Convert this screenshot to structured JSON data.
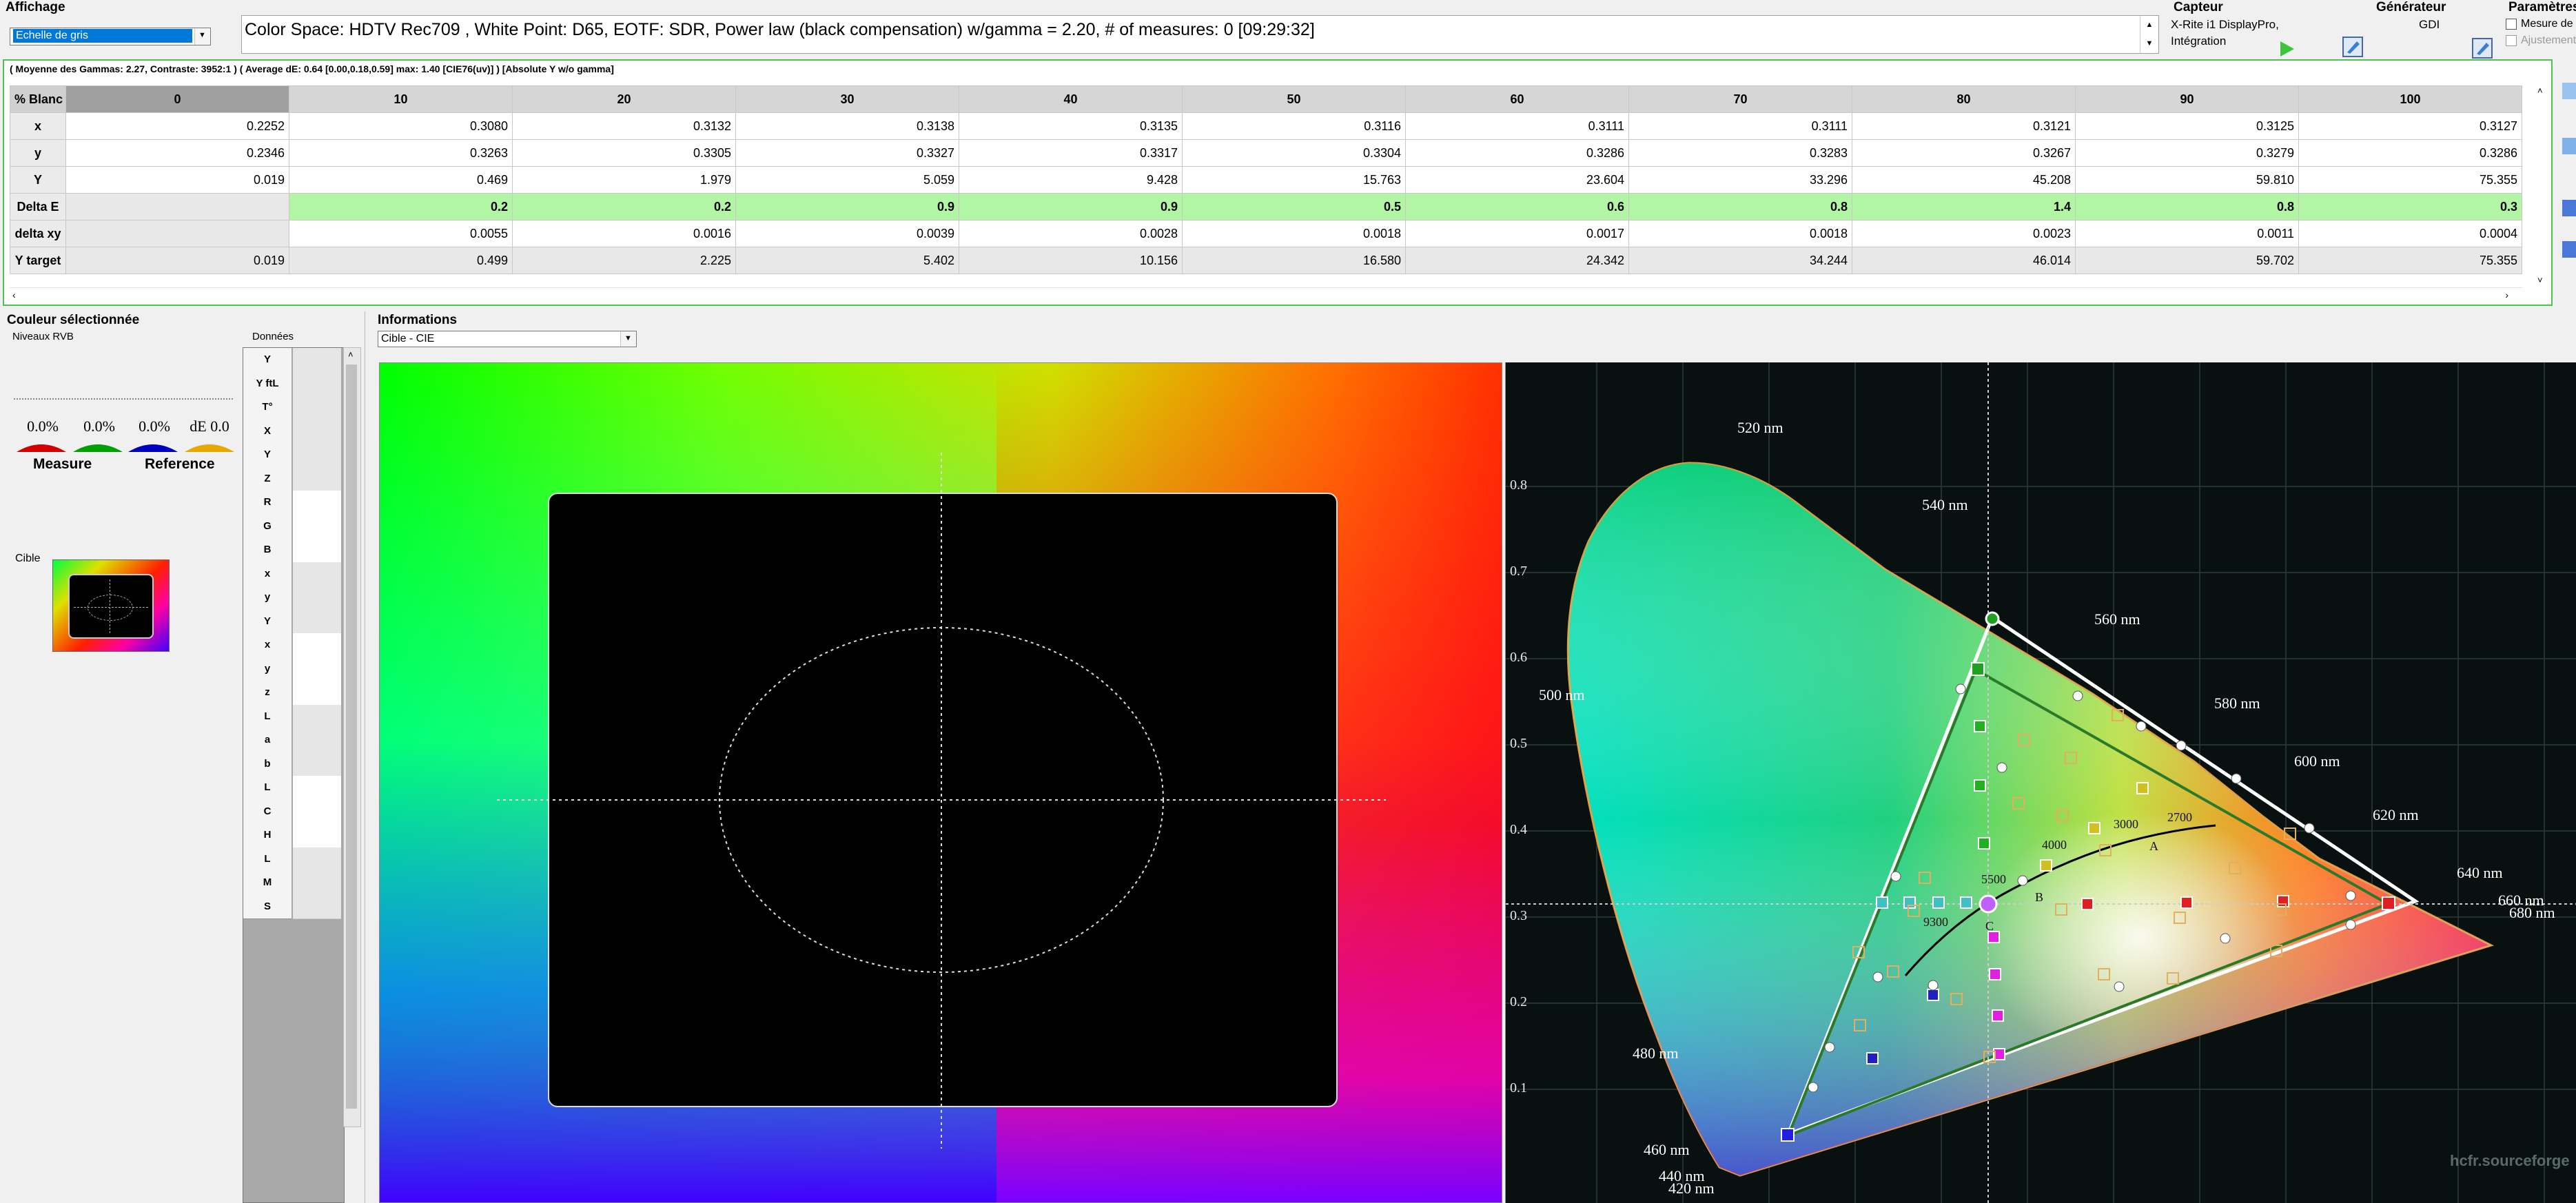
{
  "display": {
    "group_label": "Affichage",
    "mode": "Echelle de gris",
    "status": "Color Space: HDTV Rec709 , White Point: D65, EOTF:  SDR, Power law (black compensation) w/gamma = 2.20, # of measures: 0 [09:29:32]"
  },
  "sensor": {
    "group_label": "Capteur",
    "device": "X-Rite i1 DisplayPro,",
    "mode": "Intégration"
  },
  "generator": {
    "group_label": "Générateur",
    "value": "GDI"
  },
  "params": {
    "group_label": "Paramètres",
    "check1": "Mesure de",
    "check2": "Ajustement"
  },
  "summary": "( Moyenne des Gammas: 2.27, Contraste: 3952:1 ) ( Average dE: 0.64 [0.00,0.18,0.59] max: 1.40 [CIE76(uv)] ) [Absolute Y w/o gamma]",
  "table": {
    "corner": "% Blanc",
    "columns": [
      "0",
      "10",
      "20",
      "30",
      "40",
      "50",
      "60",
      "70",
      "80",
      "90",
      "100"
    ],
    "rows": [
      {
        "label": "x",
        "values": [
          "0.2252",
          "0.3080",
          "0.3132",
          "0.3138",
          "0.3135",
          "0.3116",
          "0.3111",
          "0.3111",
          "0.3121",
          "0.3125",
          "0.3127"
        ]
      },
      {
        "label": "y",
        "values": [
          "0.2346",
          "0.3263",
          "0.3305",
          "0.3327",
          "0.3317",
          "0.3304",
          "0.3286",
          "0.3283",
          "0.3267",
          "0.3279",
          "0.3286"
        ]
      },
      {
        "label": "Y",
        "values": [
          "0.019",
          "0.469",
          "1.979",
          "5.059",
          "9.428",
          "15.763",
          "23.604",
          "33.296",
          "45.208",
          "59.810",
          "75.355"
        ]
      },
      {
        "label": "Delta E",
        "values": [
          "",
          "0.2",
          "0.2",
          "0.9",
          "0.9",
          "0.5",
          "0.6",
          "0.8",
          "1.4",
          "0.8",
          "0.3"
        ]
      },
      {
        "label": "delta xy",
        "values": [
          "",
          "0.0055",
          "0.0016",
          "0.0039",
          "0.0028",
          "0.0018",
          "0.0017",
          "0.0018",
          "0.0023",
          "0.0011",
          "0.0004"
        ]
      },
      {
        "label": "Y target",
        "values": [
          "0.019",
          "0.499",
          "2.225",
          "5.402",
          "10.156",
          "16.580",
          "24.342",
          "34.244",
          "46.014",
          "59.702",
          "75.355"
        ]
      }
    ]
  },
  "selected": {
    "group_label": "Couleur sélectionnée",
    "levels_label": "Niveaux RVB",
    "pct_r": "0.0%",
    "pct_g": "0.0%",
    "pct_b": "0.0%",
    "de": "dE 0.0",
    "measure_label": "Measure",
    "reference_label": "Reference",
    "target_label": "Cible",
    "data_label": "Données",
    "data_rows": [
      "Y",
      "Y ftL",
      "T°",
      "X",
      "Y",
      "Z",
      "R",
      "G",
      "B",
      "x",
      "y",
      "Y",
      "x",
      "y",
      "z",
      "L",
      "a",
      "b",
      "L",
      "C",
      "H",
      "L",
      "M",
      "S"
    ]
  },
  "info": {
    "group_label": "Informations",
    "view": "Cible - CIE"
  },
  "cie": {
    "y_ticks": [
      "0.8",
      "0.7",
      "0.6",
      "0.5",
      "0.4",
      "0.3",
      "0.2",
      "0.1"
    ],
    "wavelengths": [
      "520 nm",
      "540 nm",
      "560 nm",
      "580 nm",
      "600 nm",
      "620 nm",
      "640 nm",
      "660 nm",
      "680 nm",
      "500 nm",
      "480 nm",
      "460 nm",
      "440 nm",
      "420 nm"
    ],
    "cct": [
      "3000",
      "2700",
      "4000",
      "5500",
      "9300"
    ],
    "points": [
      "A",
      "B",
      "C"
    ],
    "watermark": "hcfr.sourceforge"
  },
  "colors": {
    "accent": "#0078d7",
    "delta_ok": "#b2f5a5",
    "chart_bg": "#081010"
  }
}
